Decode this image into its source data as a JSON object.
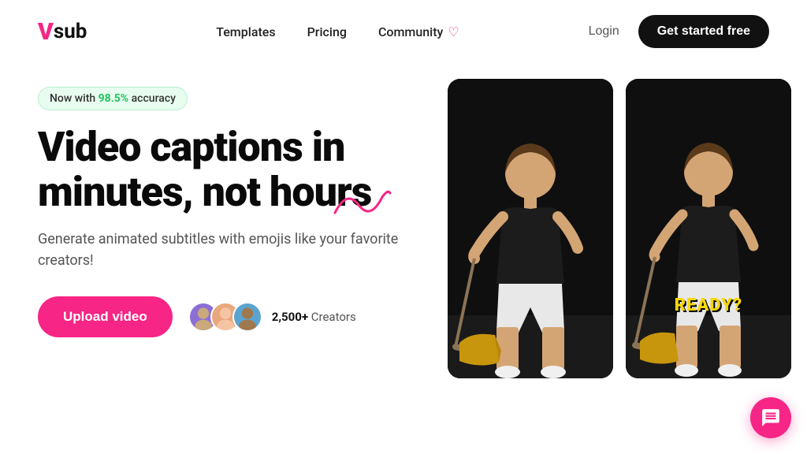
{
  "nav": {
    "logo_v": "V",
    "logo_sub": "sub",
    "links": [
      {
        "id": "templates",
        "label": "Templates"
      },
      {
        "id": "pricing",
        "label": "Pricing"
      },
      {
        "id": "community",
        "label": "Community"
      }
    ],
    "login_label": "Login",
    "cta_label": "Get started free"
  },
  "hero": {
    "badge_prefix": "Now with ",
    "badge_highlight": "98.5%",
    "badge_suffix": " accuracy",
    "title": "Video captions in minutes, not hours",
    "subtitle": "Generate animated subtitles with emojis like your favorite creators!",
    "upload_label": "Upload video",
    "creators_count": "2,500+",
    "creators_label": "Creators"
  },
  "video_right": {
    "caption": "READY?"
  },
  "chat": {
    "icon_label": "chat-icon"
  }
}
